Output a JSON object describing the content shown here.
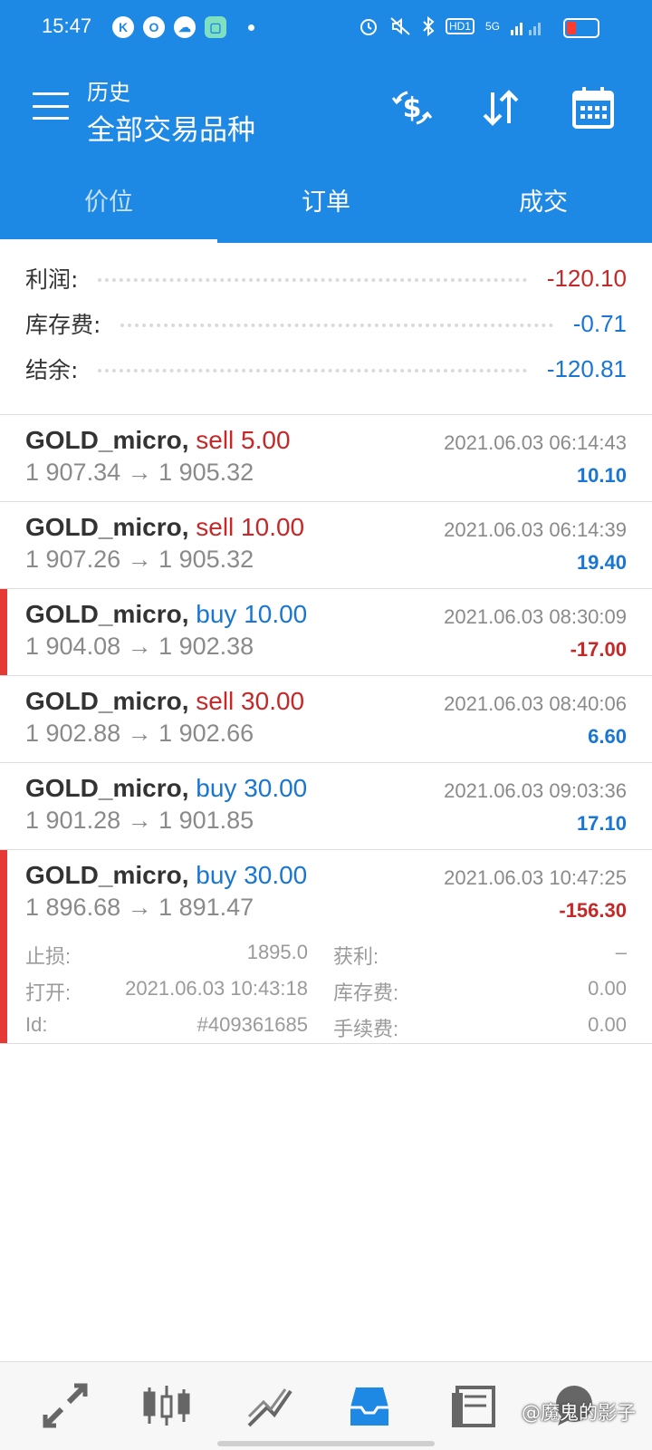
{
  "status_bar": {
    "time": "15:47",
    "icons_left": [
      "K",
      "O",
      "☁",
      "▢"
    ],
    "network_label": "HD1",
    "network_gen": "5G"
  },
  "header": {
    "subtitle": "历史",
    "title": "全部交易品种",
    "icons": [
      "currency-exchange-icon",
      "sort-icon",
      "calendar-icon"
    ]
  },
  "tabs": [
    {
      "label": "价位",
      "active": true
    },
    {
      "label": "订单",
      "active": false
    },
    {
      "label": "成交",
      "active": false
    }
  ],
  "summary": {
    "profit_label": "利润:",
    "profit_value": "-120.10",
    "swap_label": "库存费:",
    "swap_value": "-0.71",
    "balance_label": "结余:",
    "balance_value": "-120.81"
  },
  "trades": [
    {
      "symbol": "GOLD_micro,",
      "side": "sell",
      "volume_text": "sell 5.00",
      "prices": "1 907.34 → 1 905.32",
      "time": "2021.06.03 06:14:43",
      "profit": "10.10"
    },
    {
      "symbol": "GOLD_micro,",
      "side": "sell",
      "volume_text": "sell 10.00",
      "prices": "1 907.26 → 1 905.32",
      "time": "2021.06.03 06:14:39",
      "profit": "19.40"
    },
    {
      "symbol": "GOLD_micro,",
      "side": "buy",
      "volume_text": "buy 10.00",
      "prices": "1 904.08 → 1 902.38",
      "time": "2021.06.03 08:30:09",
      "profit": "-17.00"
    },
    {
      "symbol": "GOLD_micro,",
      "side": "sell",
      "volume_text": "sell 30.00",
      "prices": "1 902.88 → 1 902.66",
      "time": "2021.06.03 08:40:06",
      "profit": "6.60"
    },
    {
      "symbol": "GOLD_micro,",
      "side": "buy",
      "volume_text": "buy 30.00",
      "prices": "1 901.28 → 1 901.85",
      "time": "2021.06.03 09:03:36",
      "profit": "17.10"
    },
    {
      "symbol": "GOLD_micro,",
      "side": "buy",
      "volume_text": "buy 30.00",
      "prices": "1 896.68 → 1 891.47",
      "time": "2021.06.03 10:47:25",
      "profit": "-156.30"
    }
  ],
  "expanded_trade": {
    "sl_label": "止损:",
    "sl_value": "1895.0",
    "tp_label": "获利:",
    "tp_value": "–",
    "open_label": "打开:",
    "open_value": "2021.06.03 10:43:18",
    "swap_label": "库存费:",
    "swap_value": "0.00",
    "id_label": "Id:",
    "id_value": "#409361685",
    "commission_label": "手续费:",
    "commission_value": "0.00"
  },
  "bottom_nav": {
    "items": [
      "quotes-icon",
      "chart-icon",
      "trade-icon",
      "history-icon",
      "news-icon",
      "chat-icon"
    ],
    "active": "history-icon",
    "watermark": "@魔鬼的影子"
  },
  "colors": {
    "header_bg": "#1e88e5",
    "negative": "#c62828",
    "positive": "#1976d2",
    "loss_marker": "#e53935"
  }
}
